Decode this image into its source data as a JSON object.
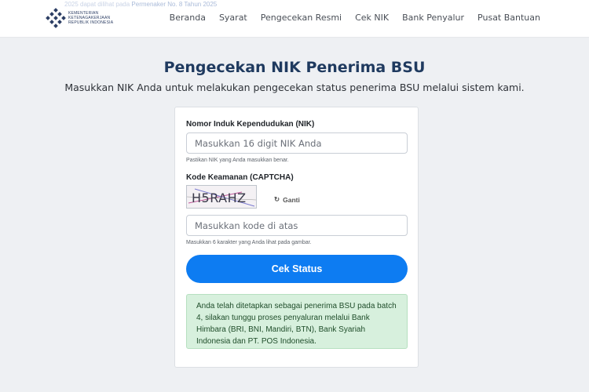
{
  "header": {
    "ticker_text": "2025 dapat dilihat pada",
    "ticker_link": "Permenaker No. 8 Tahun 2025",
    "logo_lines": [
      "KEMENTERIAN",
      "KETENAGAKERJAAN",
      "REPUBLIK INDONESIA"
    ],
    "nav": [
      "Beranda",
      "Syarat",
      "Pengecekan Resmi",
      "Cek NIK",
      "Bank Penyalur",
      "Pusat Bantuan"
    ]
  },
  "main": {
    "title": "Pengecekan NIK Penerima BSU",
    "subtitle": "Masukkan NIK Anda untuk melakukan pengecekan status penerima BSU melalui sistem kami."
  },
  "form": {
    "nik_label": "Nomor Induk Kependudukan (NIK)",
    "nik_placeholder": "Masukkan 16 digit NIK Anda",
    "nik_hint": "Pastikan NIK yang Anda masukkan benar.",
    "captcha_label": "Kode Keamanan (CAPTCHA)",
    "captcha_code": "H5RAHZ",
    "refresh_label": "Ganti",
    "captcha_placeholder": "Masukkan kode di atas",
    "captcha_hint": "Masukkan 6 karakter yang Anda lihat pada gambar.",
    "submit_label": "Cek Status",
    "result_message": "Anda telah ditetapkan sebagai penerima BSU pada batch 4, silakan tunggu proses penyaluran melalui Bank Himbara (BRI, BNI, Mandiri, BTN), Bank Syariah Indonesia dan PT. POS Indonesia."
  },
  "colors": {
    "primary": "#0d7cf2",
    "success_bg": "#d7f0dd",
    "title": "#1f3a5f"
  }
}
